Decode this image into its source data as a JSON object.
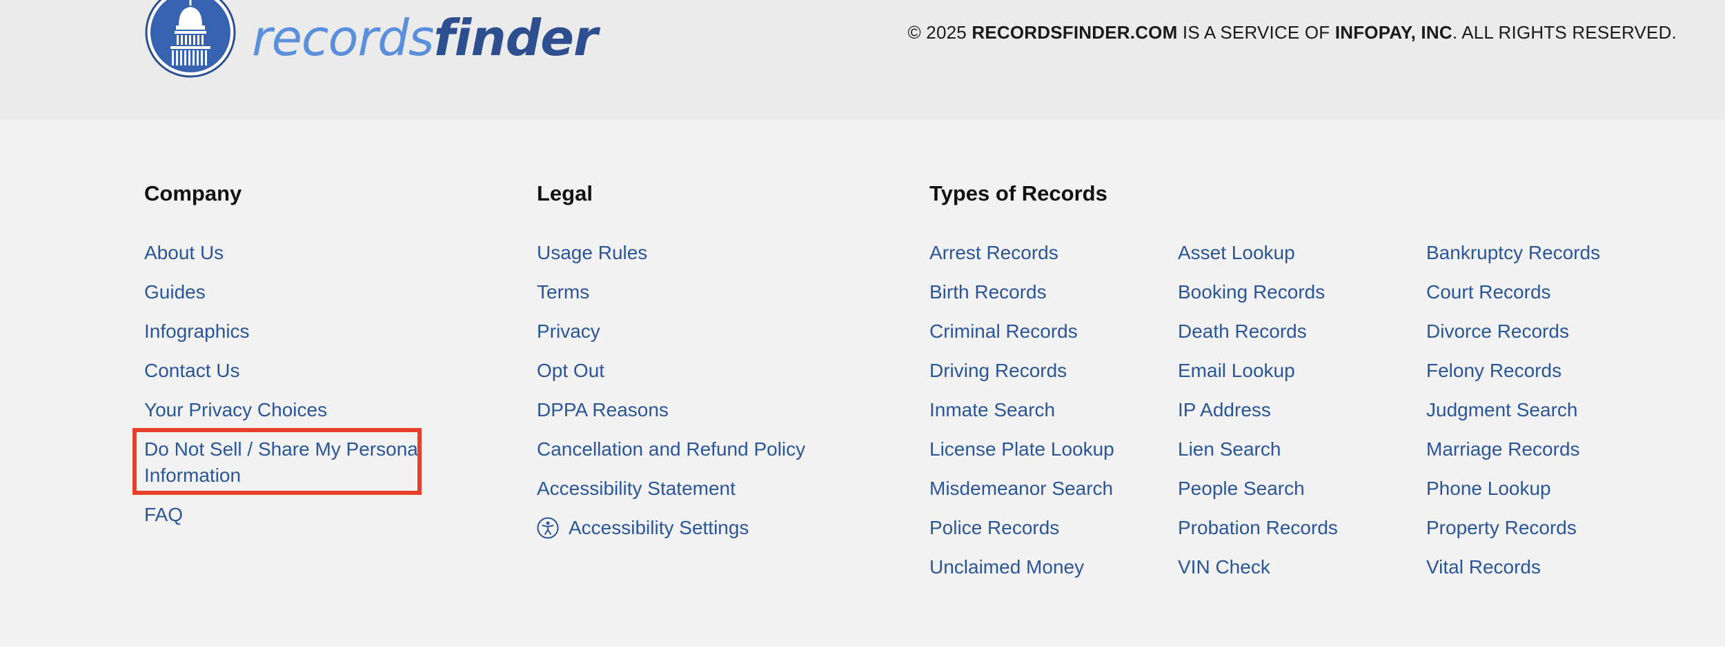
{
  "brand": {
    "logo_light": "records",
    "logo_bold": "finder"
  },
  "copyright": {
    "prefix": "© 2025 ",
    "site": "RECORDSFINDER.COM",
    "middle": " IS A SERVICE OF ",
    "company": "INFOPAY, INC",
    "suffix": ". ALL RIGHTS RESERVED."
  },
  "footer": {
    "company": {
      "heading": "Company",
      "links": [
        "About Us",
        "Guides",
        "Infographics",
        "Contact Us",
        "Your Privacy Choices",
        "Do Not Sell / Share My Personal Information",
        "FAQ"
      ]
    },
    "legal": {
      "heading": "Legal",
      "links": [
        "Usage Rules",
        "Terms",
        "Privacy",
        "Opt Out",
        "DPPA Reasons",
        "Cancellation and Refund Policy",
        "Accessibility Statement",
        "Accessibility Settings"
      ]
    },
    "types": {
      "heading": "Types of Records",
      "col1": [
        "Arrest Records",
        "Birth Records",
        "Criminal Records",
        "Driving Records",
        "Inmate Search",
        "License Plate Lookup",
        "Misdemeanor Search",
        "Police Records",
        "Unclaimed Money"
      ],
      "col2": [
        "Asset Lookup",
        "Booking Records",
        "Death Records",
        "Email Lookup",
        "IP Address",
        "Lien Search",
        "People Search",
        "Probation Records",
        "VIN Check"
      ],
      "col3": [
        "Bankruptcy Records",
        "Court Records",
        "Divorce Records",
        "Felony Records",
        "Judgment Search",
        "Marriage Records",
        "Phone Lookup",
        "Property Records",
        "Vital Records"
      ]
    }
  },
  "colors": {
    "link": "#2a5597",
    "highlight": "#e8402a",
    "logo_light": "#5a8fdc",
    "logo_bold": "#2d4f8f"
  },
  "icons": {
    "logo": "capitol-building-icon",
    "accessibility": "accessibility-person-icon"
  }
}
